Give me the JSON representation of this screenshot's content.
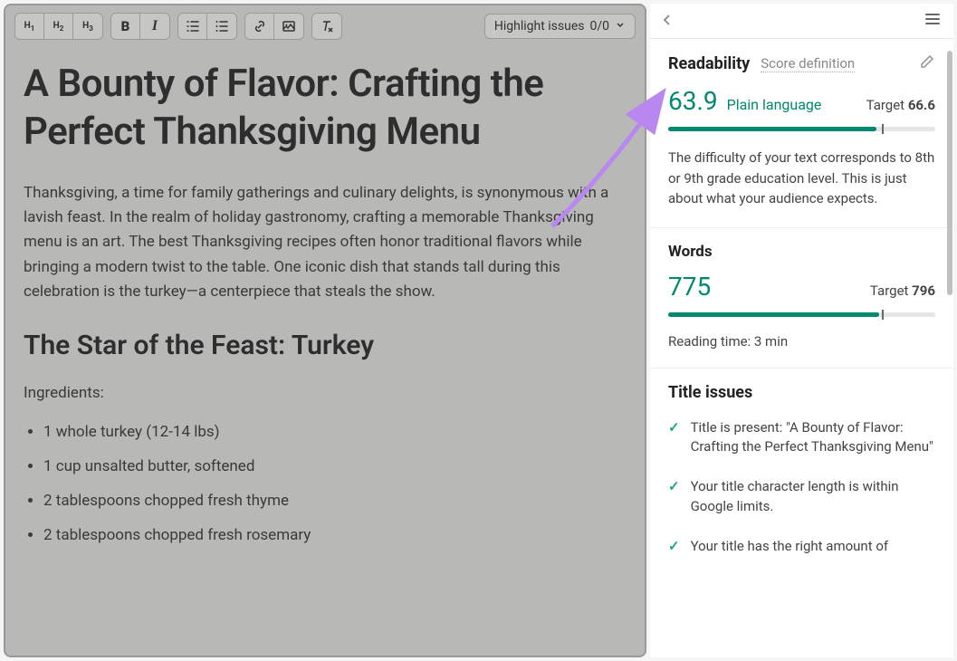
{
  "toolbar": {
    "h1": "H1",
    "h2": "H2",
    "h3": "H3",
    "bold": "B",
    "italic": "I",
    "highlight_label": "Highlight issues",
    "highlight_count": "0/0"
  },
  "article": {
    "title": "A Bounty of Flavor: Crafting the Perfect Thanksgiving Menu",
    "intro": "Thanksgiving, a time for family gatherings and culinary delights, is synonymous with a lavish feast. In the realm of holiday gastronomy, crafting a memorable Thanksgiving menu is an art. The best Thanksgiving recipes often honor traditional flavors while bringing a modern twist to the table. One iconic dish that stands tall during this celebration is the turkey—a centerpiece that steals the show.",
    "h2": "The Star of the Feast: Turkey",
    "ingredients_label": "Ingredients:",
    "ingredients": [
      "1 whole turkey (12-14 lbs)",
      "1 cup unsalted butter, softened",
      "2 tablespoons chopped fresh thyme",
      "2 tablespoons chopped fresh rosemary"
    ]
  },
  "sidebar": {
    "readability": {
      "title": "Readability",
      "score_def": "Score definition",
      "score": "63.9",
      "label": "Plain language",
      "target_label": "Target",
      "target_value": "66.6",
      "progress_pct": 78,
      "progress_target_pct": 80,
      "description": "The difficulty of your text corresponds to 8th or 9th grade education level. This is just about what your audience expects."
    },
    "words": {
      "title": "Words",
      "count": "775",
      "target_label": "Target",
      "target_value": "796",
      "progress_pct": 79,
      "progress_target_pct": 80,
      "reading_time": "Reading time: 3 min"
    },
    "title_issues": {
      "title": "Title issues",
      "items": [
        "Title is present: \"A Bounty of Flavor: Crafting the Perfect Thanksgiving Menu\"",
        "Your title character length is within Google limits.",
        "Your title has the right amount of"
      ]
    }
  }
}
